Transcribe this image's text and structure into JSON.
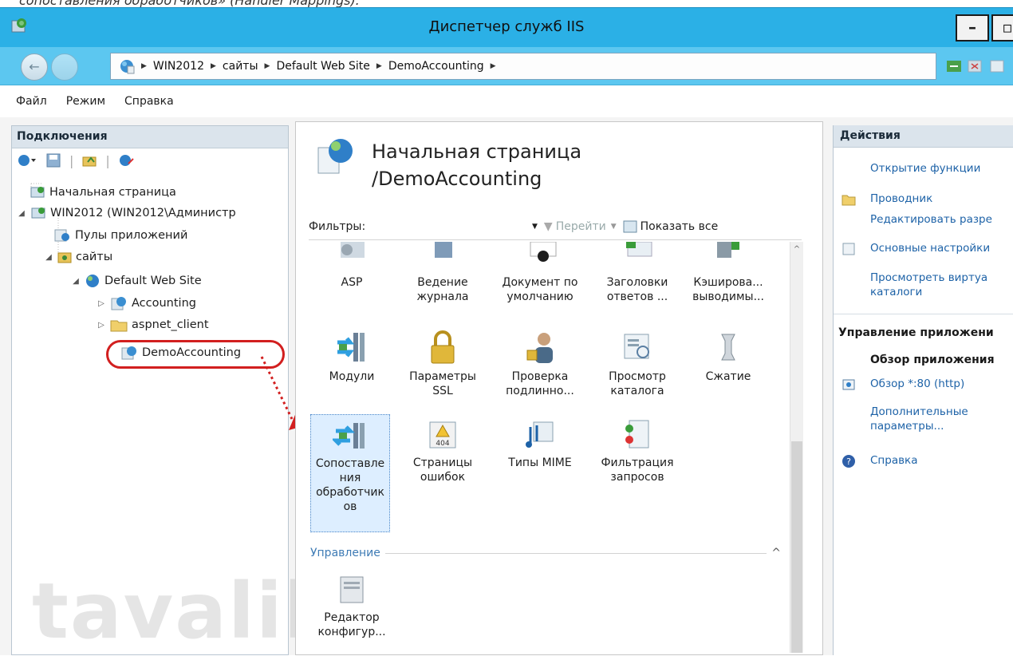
{
  "caption": "сопоставления обработчиков» (Handler Mappings):",
  "window": {
    "title": "Диспетчер служб IIS",
    "minimize_glyph": "–",
    "restore_glyph": "▫"
  },
  "address": {
    "back_glyph": "←",
    "breadcrumb": [
      "WIN2012",
      "сайты",
      "Default Web Site",
      "DemoAccounting"
    ]
  },
  "menu": [
    "Файл",
    "Режим",
    "Справка"
  ],
  "connections": {
    "header": "Подключения",
    "tree": {
      "start_page": "Начальная страница",
      "server": "WIN2012 (WIN2012\\Администр",
      "app_pools": "Пулы приложений",
      "sites": "сайты",
      "default_site": "Default Web Site",
      "accounting": "Accounting",
      "aspnet_client": "aspnet_client",
      "demo": "DemoAccounting"
    }
  },
  "center": {
    "title_line1": "Начальная страница",
    "title_line2": "/DemoAccounting",
    "filter_label": "Фильтры:",
    "go_label": "Перейти",
    "show_all_label": "Показать все",
    "features": [
      {
        "label": "ASP"
      },
      {
        "label": "Ведение журнала"
      },
      {
        "label": "Документ по умолчанию"
      },
      {
        "label": "Заголовки ответов ..."
      },
      {
        "label": "Кэширова... выводимы..."
      },
      {
        "label": "Модули"
      },
      {
        "label": "Параметры SSL"
      },
      {
        "label": "Проверка подлинно..."
      },
      {
        "label": "Просмотр каталога"
      },
      {
        "label": "Сжатие"
      },
      {
        "label": "Сопоставле ния обработчик ов"
      },
      {
        "label": "Страницы ошибок"
      },
      {
        "label": "Типы MIME"
      },
      {
        "label": "Фильтрация запросов"
      }
    ],
    "section_management": "Управление",
    "config_editor": "Редактор конфигур...",
    "error_badge": "404"
  },
  "actions": {
    "header": "Действия",
    "open_feature": "Открытие функции",
    "explorer": "Проводник",
    "edit_permissions": "Редактировать разре",
    "basic_settings": "Основные настройки",
    "view_virtual_dirs": "Просмотреть виртуа каталоги",
    "manage_app_header": "Управление приложени",
    "browse_app_header": "Обзор приложения",
    "browse_80": "Обзор *:80 (http)",
    "advanced_settings": "Дополнительные параметры...",
    "help": "Справка"
  },
  "watermark": "tavalik.ru",
  "colors": {
    "titlebar": "#2bb0e6",
    "addressbar": "#5cc7f0",
    "link": "#1d62a7",
    "highlight": "#d21f1f"
  }
}
